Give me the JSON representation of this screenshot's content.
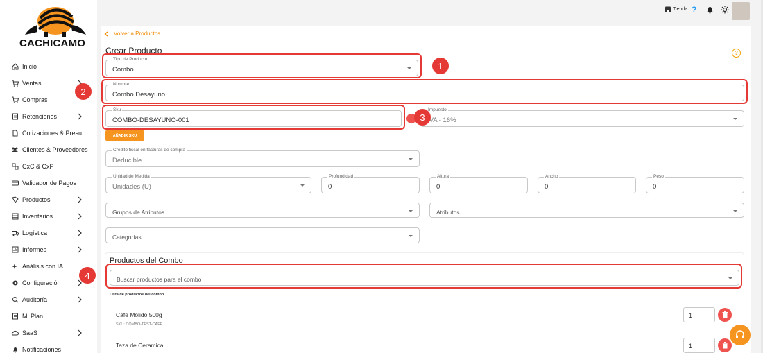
{
  "brand": {
    "name": "CACHICAMO"
  },
  "sidebar": {
    "items": [
      {
        "label": "Inicio",
        "icon": "home-icon",
        "chevron": false
      },
      {
        "label": "Ventas",
        "icon": "cart-icon",
        "chevron": true
      },
      {
        "label": "Compras",
        "icon": "cart-icon",
        "chevron": false
      },
      {
        "label": "Retenciones",
        "icon": "document-icon",
        "chevron": true
      },
      {
        "label": "Cotizaciones & Presu...",
        "icon": "file-icon",
        "chevron": false
      },
      {
        "label": "Clientes & Proveedores",
        "icon": "people-icon",
        "chevron": false
      },
      {
        "label": "CxC & CxP",
        "icon": "exchange-icon",
        "chevron": false
      },
      {
        "label": "Validador de Pagos",
        "icon": "card-icon",
        "chevron": false
      },
      {
        "label": "Productos",
        "icon": "product-icon",
        "chevron": true
      },
      {
        "label": "Inventarios",
        "icon": "inventory-icon",
        "chevron": true
      },
      {
        "label": "Logística",
        "icon": "truck-icon",
        "chevron": true
      },
      {
        "label": "Informes",
        "icon": "report-icon",
        "chevron": true
      },
      {
        "label": "Análisis con IA",
        "icon": "sparkle-icon",
        "chevron": false
      },
      {
        "label": "Configuración",
        "icon": "gear-icon",
        "chevron": true
      },
      {
        "label": "Auditoría",
        "icon": "audit-icon",
        "chevron": true
      },
      {
        "label": "Mi Plan",
        "icon": "plan-icon",
        "chevron": false
      },
      {
        "label": "SaaS",
        "icon": "cloud-icon",
        "chevron": true
      },
      {
        "label": "Notificaciones",
        "icon": "bell-icon",
        "chevron": false
      }
    ]
  },
  "topbar": {
    "store_label": "Tienda",
    "help": "?"
  },
  "page": {
    "back_label": "Volver a Productos",
    "title": "Crear Producto",
    "help": "?"
  },
  "form": {
    "tipo": {
      "label": "Tipo de Producto",
      "value": "Combo"
    },
    "nombre": {
      "label": "Nombre",
      "value": "Combo Desayuno"
    },
    "sku": {
      "label": "Sku",
      "value": "COMBO-DESAYUNO-001"
    },
    "impuesto": {
      "label": "Impuesto",
      "value": "IVA - 16%"
    },
    "add_sku_label": "AÑADIR SKU",
    "credito": {
      "label": "Crédito fiscal en facturas de compra",
      "value": "Deducible"
    },
    "unidad": {
      "label": "Unidad de Medida",
      "value": "Unidades (U)"
    },
    "profundidad": {
      "label": "Profundidad",
      "value": "0"
    },
    "altura": {
      "label": "Altura",
      "value": "0"
    },
    "ancho": {
      "label": "Ancho",
      "value": "0"
    },
    "peso": {
      "label": "Peso",
      "value": "0"
    },
    "grupos": {
      "placeholder": "Grupos de Atributos"
    },
    "atributos": {
      "placeholder": "Atributos"
    },
    "categorias": {
      "placeholder": "Categorías"
    }
  },
  "combo": {
    "title": "Productos del Combo",
    "search_placeholder": "Buscar productos para el combo",
    "list_title": "Lista de productos del combo",
    "products": [
      {
        "name": "Cafe Molido 500g",
        "sku": "SKU: COMBO-TEST-CAFE",
        "qty": "1"
      },
      {
        "name": "Taza de Ceramica",
        "sku": "",
        "qty": "1"
      }
    ]
  },
  "annotations": [
    "1",
    "2",
    "3",
    "4"
  ],
  "colors": {
    "accent": "#f5941f",
    "highlight": "#e53935",
    "delete": "#ef5350"
  }
}
